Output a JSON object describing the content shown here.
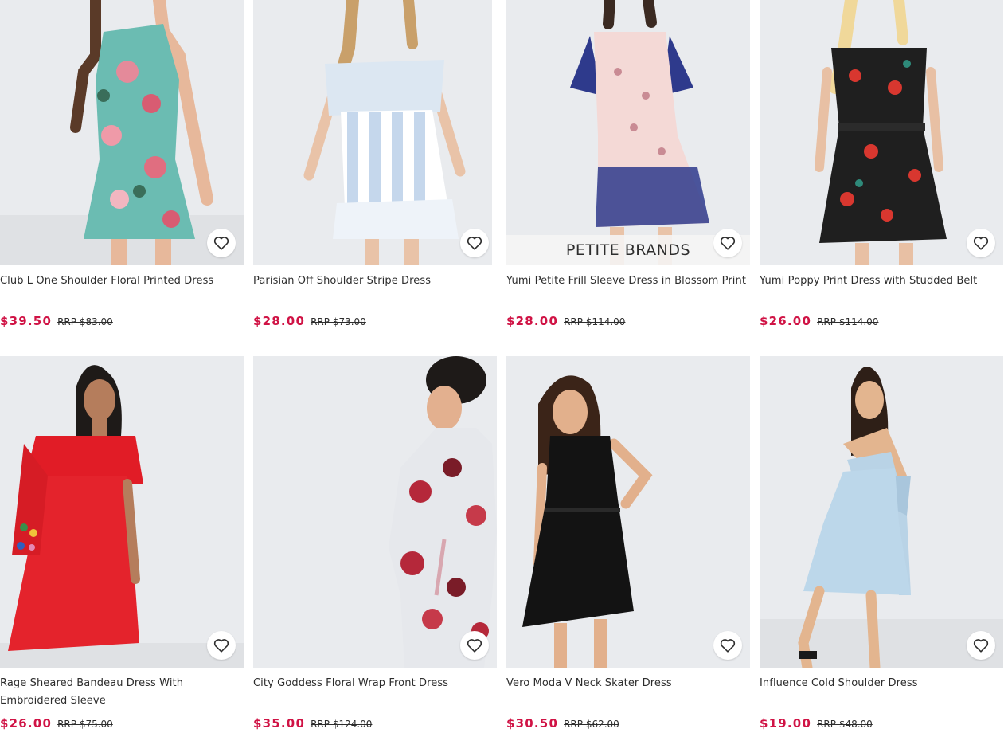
{
  "products": [
    {
      "title": "Club L One Shoulder Floral Printed Dress",
      "price": "$39.50",
      "rrp": "RRP $83.00",
      "image": "model-teal-floral-one-shoulder-dress",
      "banner": ""
    },
    {
      "title": "Parisian Off Shoulder Stripe Dress",
      "price": "$28.00",
      "rrp": "RRP $73.00",
      "image": "model-blue-white-stripe-ruffle-dress",
      "banner": ""
    },
    {
      "title": "Yumi Petite Frill Sleeve Dress in Blossom Print",
      "price": "$28.00",
      "rrp": "RRP $114.00",
      "image": "model-pink-navy-blossom-dress",
      "banner": "PETITE BRANDS"
    },
    {
      "title": "Yumi Poppy Print Dress with Studded Belt",
      "price": "$26.00",
      "rrp": "RRP $114.00",
      "image": "model-black-red-poppy-dress",
      "banner": ""
    },
    {
      "title": "Rage Sheared Bandeau Dress With Embroidered Sleeve",
      "price": "$26.00",
      "rrp": "RRP $75.00",
      "image": "model-red-bandeau-dress",
      "banner": ""
    },
    {
      "title": "City Goddess Floral Wrap Front Dress",
      "price": "$35.00",
      "rrp": "RRP $124.00",
      "image": "model-grey-red-floral-wrap-dress",
      "banner": ""
    },
    {
      "title": "Vero Moda V Neck Skater Dress",
      "price": "$30.50",
      "rrp": "RRP $62.00",
      "image": "model-black-skater-dress",
      "banner": ""
    },
    {
      "title": "Influence Cold Shoulder Dress",
      "price": "$19.00",
      "rrp": "RRP $48.00",
      "image": "model-light-blue-cold-shoulder-dress",
      "banner": ""
    }
  ],
  "colors": {
    "price": "#d01345",
    "text": "#2d2d2d",
    "photo_bg": "#eceef0"
  },
  "icons": {
    "save": "heart-outline-icon"
  }
}
